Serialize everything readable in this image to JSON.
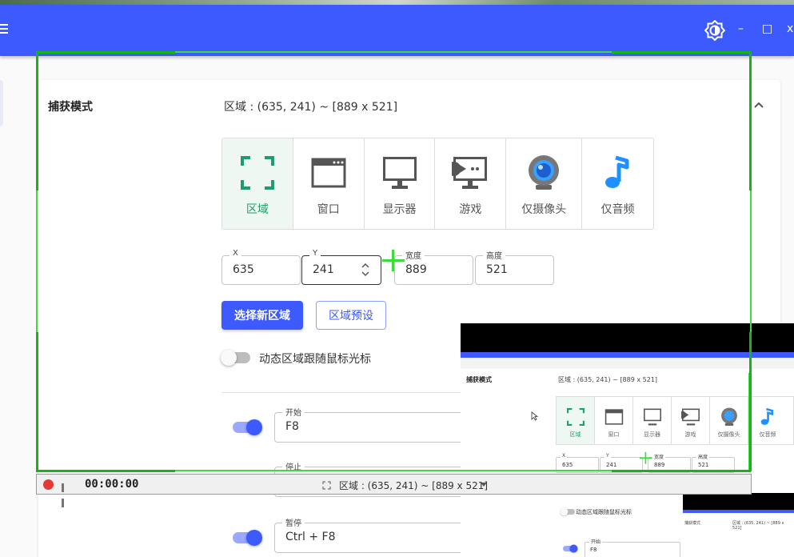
{
  "colors": {
    "accent": "#3d5afe",
    "capture_green": "#3ddc3d",
    "active_mode_text": "#1b9e6b"
  },
  "appbar": {
    "menu_icon": "hamburger-menu-icon",
    "theme_icon": "brightness-icon",
    "minimize": "–",
    "maximize": "□",
    "close": "x"
  },
  "section": {
    "title": "捕获模式",
    "summary": "区域 : (635, 241) ~ [889 x 521]",
    "collapse_icon": "chevron-up-icon"
  },
  "modes": [
    {
      "label": "区域",
      "icon": "region-select-icon",
      "active": true
    },
    {
      "label": "窗口",
      "icon": "window-icon",
      "active": false
    },
    {
      "label": "显示器",
      "icon": "monitor-icon",
      "active": false
    },
    {
      "label": "游戏",
      "icon": "game-icon",
      "active": false
    },
    {
      "label": "仅摄像头",
      "icon": "webcam-icon",
      "active": false
    },
    {
      "label": "仅音频",
      "icon": "music-note-icon",
      "active": false
    }
  ],
  "region": {
    "x_label": "X",
    "x_value": "635",
    "y_label": "Y",
    "y_value": "241",
    "w_label": "宽度",
    "w_value": "889",
    "h_label": "高度",
    "h_value": "521"
  },
  "buttons": {
    "select_region": "选择新区域",
    "region_presets": "区域预设"
  },
  "follow_mouse": {
    "label": "动态区域跟随鼠标光标",
    "enabled": false
  },
  "hotkeys": [
    {
      "label": "开始",
      "value": "F8",
      "enabled": true
    },
    {
      "label": "停止",
      "value": "",
      "enabled": true
    },
    {
      "label": "暂停",
      "value": "Ctrl + F8",
      "enabled": true
    }
  ],
  "capture_bar": {
    "timer": "00:00:00",
    "region_text": "区域 : (635, 241) ~ [889 x 521]",
    "icons": [
      "camera-icon",
      "pen-icon",
      "folder-icon",
      "gear-icon",
      "close-icon"
    ]
  },
  "preview": {
    "title": "捕获模式",
    "summary": "区域 : (635, 241) ~ [889 x 521]",
    "modes": [
      "区域",
      "窗口",
      "显示器",
      "游戏",
      "仅摄像头",
      "仅音频"
    ],
    "fields": [
      {
        "label": "X",
        "value": "635"
      },
      {
        "label": "Y",
        "value": "241"
      },
      {
        "label": "宽度",
        "value": "889"
      },
      {
        "label": "高度",
        "value": "521"
      }
    ],
    "nested_title": "捕获模式",
    "nested_summary": "区域 : (635, 241) ~ [889 x 521]",
    "switch_label": "动态区域跟随鼠标光标",
    "hotkey_label": "开始",
    "hotkey_value": "F8"
  }
}
